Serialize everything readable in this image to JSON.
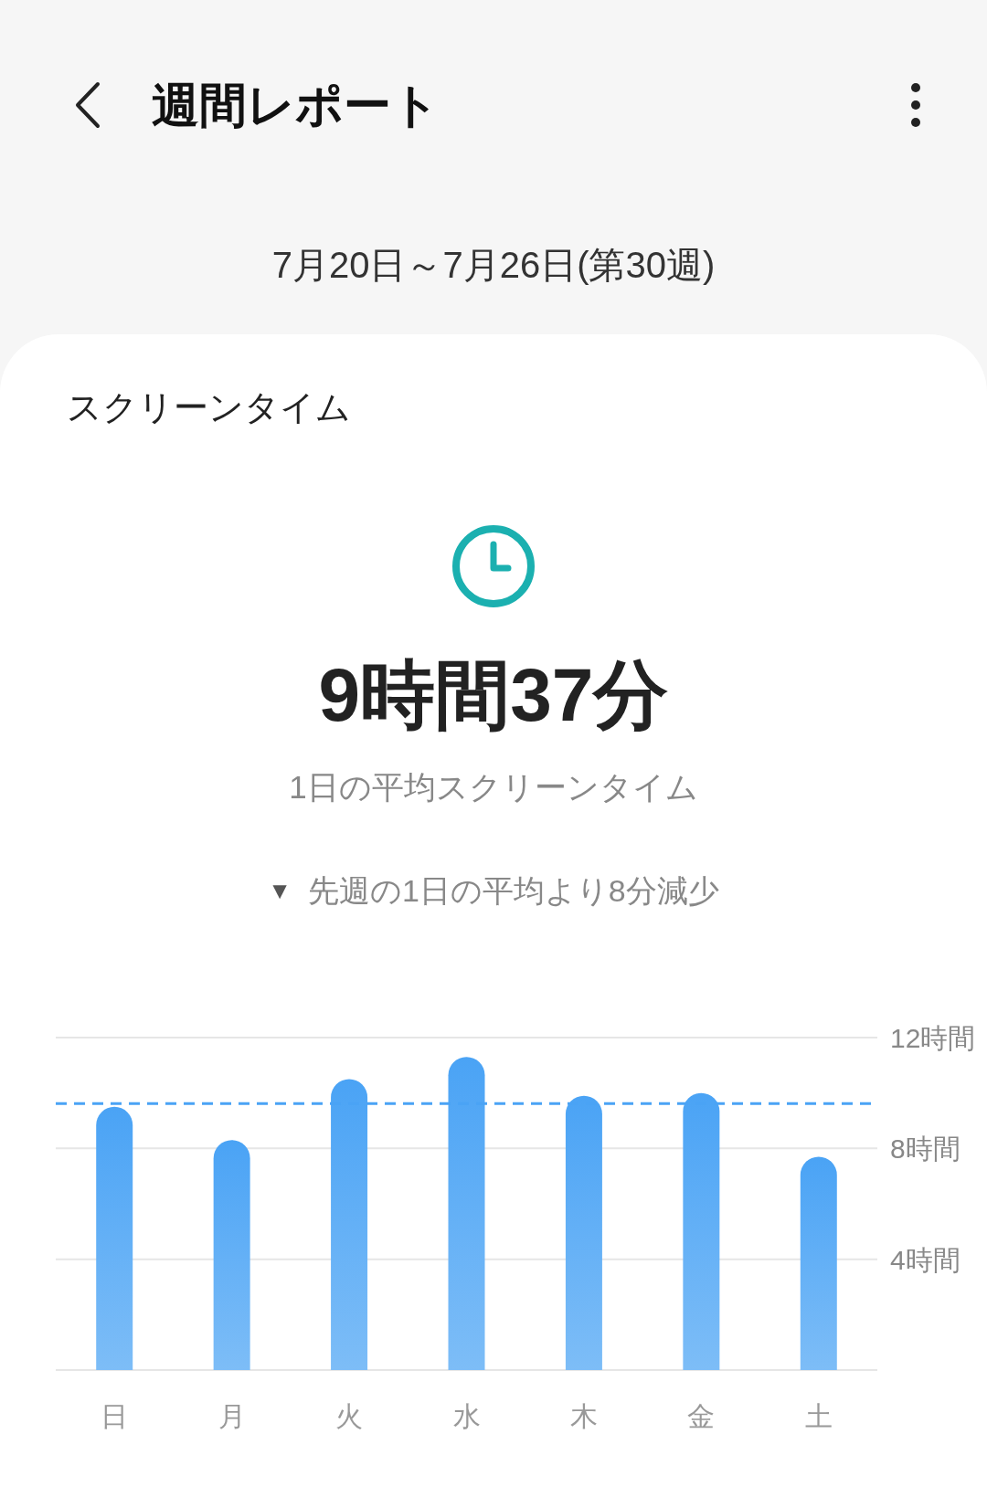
{
  "header": {
    "title": "週間レポート"
  },
  "date_range": "7月20日～7月26日(第30週)",
  "card": {
    "title": "スクリーンタイム",
    "total": "9時間37分",
    "caption": "1日の平均スクリーンタイム",
    "comparison": {
      "marker": "▼",
      "text": "先週の1日の平均より8分減少"
    },
    "chart_data": {
      "type": "bar",
      "categories": [
        "日",
        "月",
        "火",
        "水",
        "木",
        "金",
        "土"
      ],
      "values": [
        9.5,
        8.3,
        10.5,
        11.3,
        9.9,
        10.0,
        7.7
      ],
      "ylim": [
        0,
        12
      ],
      "yticks": [
        {
          "value": 4,
          "label": "4時間"
        },
        {
          "value": 8,
          "label": "8時間"
        },
        {
          "value": 12,
          "label": "12時間"
        }
      ],
      "ref_lines": [
        {
          "axis": "y",
          "value": 9.62
        }
      ]
    }
  }
}
